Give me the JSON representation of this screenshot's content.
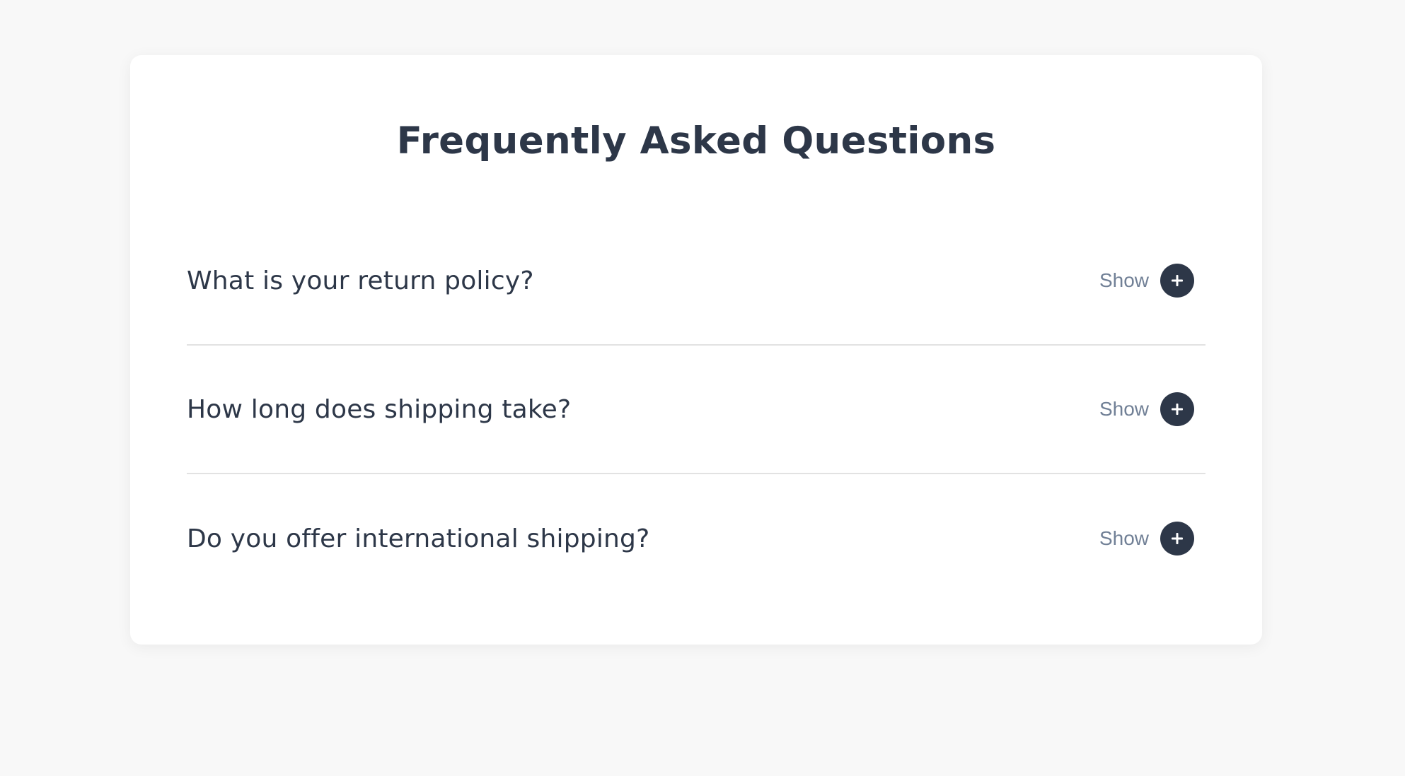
{
  "page": {
    "title": "Frequently Asked Questions"
  },
  "faq": {
    "items": [
      {
        "question": "What is your return policy?",
        "toggle_label": "Show",
        "toggle_icon": "plus-icon"
      },
      {
        "question": "How long does shipping take?",
        "toggle_label": "Show",
        "toggle_icon": "plus-icon"
      },
      {
        "question": "Do you offer international shipping?",
        "toggle_label": "Show",
        "toggle_icon": "plus-icon"
      }
    ]
  },
  "colors": {
    "background": "#f8f8f8",
    "card": "#ffffff",
    "text": "#2d3748",
    "muted": "#718096",
    "divider": "#e2e2e2"
  }
}
